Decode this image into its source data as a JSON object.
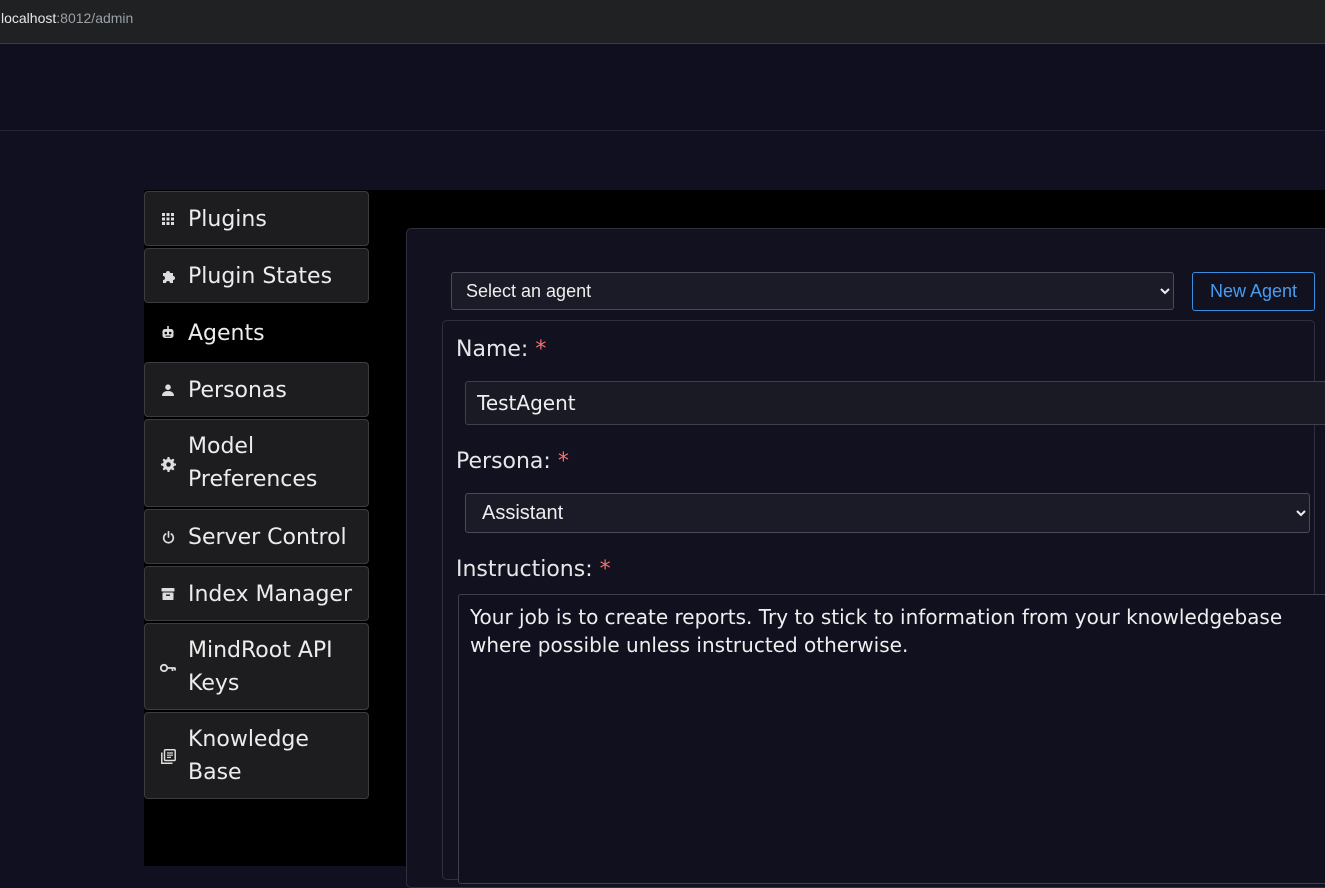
{
  "browser": {
    "url_host": "localhost",
    "url_path": ":8012/admin"
  },
  "sidebar": {
    "items": [
      {
        "label": "Plugins",
        "icon": "grid-icon"
      },
      {
        "label": "Plugin States",
        "icon": "puzzle-icon"
      },
      {
        "label": "Agents",
        "icon": "robot-icon",
        "active": true
      },
      {
        "label": "Personas",
        "icon": "user-icon"
      },
      {
        "label": "Model Preferences",
        "icon": "gear-icon"
      },
      {
        "label": "Server Control",
        "icon": "power-icon"
      },
      {
        "label": "Index Manager",
        "icon": "archive-icon"
      },
      {
        "label": "MindRoot API Keys",
        "icon": "key-icon"
      },
      {
        "label": "Knowledge Base",
        "icon": "library-icon"
      }
    ]
  },
  "agent_form": {
    "select_placeholder": "Select an agent",
    "new_agent_label": "New Agent",
    "name_label": "Name:",
    "name_value": "TestAgent",
    "persona_label": "Persona:",
    "persona_value": "Assistant",
    "instructions_label": "Instructions:",
    "instructions_value": "Your job is to create reports. Try to stick to information from your knowledgebase where possible unless instructed otherwise.",
    "required_marker": "*"
  }
}
